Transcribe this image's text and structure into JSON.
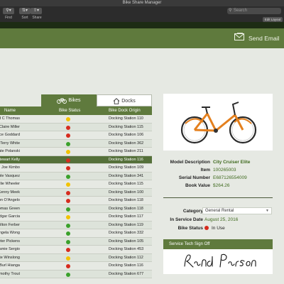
{
  "window": {
    "title": "Bike Share Manager"
  },
  "toolbar": {
    "find_label": "Find",
    "sort_label": "Sort",
    "share_label": "Share",
    "search_placeholder": "Search",
    "edit_layout": "Edit Layout"
  },
  "banner": {
    "send_email": "Send Email"
  },
  "tabs": {
    "bikes": "Bikes",
    "docks": "Docks"
  },
  "columns": {
    "name": "Name",
    "status": "Bike Status",
    "origin": "Bike Dock Origin"
  },
  "status_colors": {
    "green": "#3aa12b",
    "yellow": "#f2c300",
    "red": "#d62b1e"
  },
  "rows": [
    {
      "name": "ed C Thomas",
      "status": "yellow",
      "origin": "Docking Station 110"
    },
    {
      "name": "Claire Miller",
      "status": "red",
      "origin": "Docking Station 115"
    },
    {
      "name": "ance Goddard",
      "status": "red",
      "origin": "Docking Station 106"
    },
    {
      "name": "Terry White",
      "status": "green",
      "origin": "Docking Station 362"
    },
    {
      "name": "Kate Polanski",
      "status": "yellow",
      "origin": "Docking Station 211"
    },
    {
      "name": "Stewart Kelly",
      "status": "red",
      "origin": "Docking Station 116"
    },
    {
      "name": "Joe Kimbo",
      "status": "red",
      "origin": "Docking Station 109"
    },
    {
      "name": "ikole Vasquez",
      "status": "green",
      "origin": "Docking Station 341"
    },
    {
      "name": "Millie Wheeler",
      "status": "yellow",
      "origin": "Docking Station 115"
    },
    {
      "name": "Kenny Meek",
      "status": "red",
      "origin": "Docking Station 100"
    },
    {
      "name": "Jason O'Angelo",
      "status": "red",
      "origin": "Docking Station 118"
    },
    {
      "name": "Thomas Green",
      "status": "green",
      "origin": "Docking Station 118"
    },
    {
      "name": "Edgar Garcia",
      "status": "yellow",
      "origin": "Docking Station 117"
    },
    {
      "name": "Milton Ferber",
      "status": "green",
      "origin": "Docking Station 119"
    },
    {
      "name": "Angela Wong",
      "status": "green",
      "origin": "Docking Station 332"
    },
    {
      "name": "Peter Pickens",
      "status": "green",
      "origin": "Docking Station 105"
    },
    {
      "name": "Jamie Sergio",
      "status": "red",
      "origin": "Docking Station 453"
    },
    {
      "name": "Kate Winslong",
      "status": "yellow",
      "origin": "Docking Station 112"
    },
    {
      "name": "Burl Hianga",
      "status": "red",
      "origin": "Docking Station 116"
    },
    {
      "name": "Timothy Trout",
      "status": "green",
      "origin": "Docking Station 677"
    }
  ],
  "selected_row": 5,
  "details": {
    "model_description_label": "Model Description",
    "model_description": "City Cruiser Elite",
    "item_label": "Item",
    "item": "100265003",
    "serial_label": "Serial Number",
    "serial": "E687126554009",
    "book_value_label": "Book Value",
    "book_value": "$264.26",
    "category_label": "Category",
    "category": "General Rental",
    "service_date_label": "In Service Date",
    "service_date": "August 25, 2016",
    "bike_status_label": "Bike Status",
    "bike_status": "In Use",
    "sign_off_label": "Service Tech Sign Off",
    "signature": "Rand Parsons"
  }
}
